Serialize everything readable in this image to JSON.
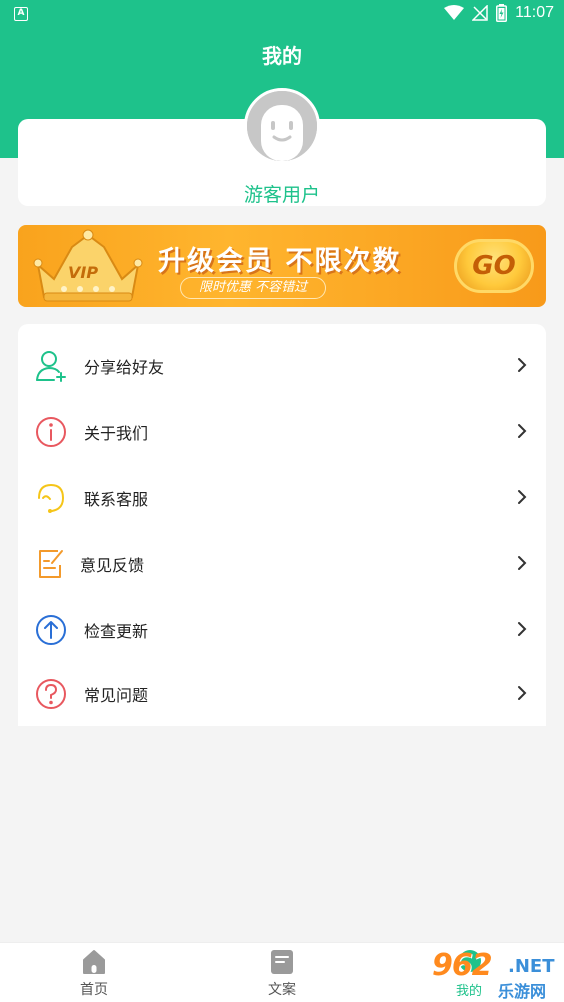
{
  "status_bar": {
    "notification_icon": "A",
    "time": "11:07",
    "icons": [
      "wifi-icon",
      "no-signal-icon",
      "battery-icon"
    ]
  },
  "header": {
    "title": "我的"
  },
  "profile": {
    "username": "游客用户",
    "avatar_icon": "default-avatar-icon"
  },
  "vip_banner": {
    "badge": "VIP",
    "headline": "升级会员 不限次数",
    "subline": "限时优惠  不容错过",
    "go_label": "GO"
  },
  "menu": {
    "items": [
      {
        "label": "分享给好友",
        "icon": "share-friend-icon",
        "color": "#1ec28b"
      },
      {
        "label": "关于我们",
        "icon": "info-icon",
        "color": "#e8585f"
      },
      {
        "label": "联系客服",
        "icon": "customer-service-icon",
        "color": "#f5c518"
      },
      {
        "label": "意见反馈",
        "icon": "feedback-icon",
        "color": "#f39a2b"
      },
      {
        "label": "检查更新",
        "icon": "update-icon",
        "color": "#2a6fd6"
      },
      {
        "label": "常见问题",
        "icon": "question-icon",
        "color": "#e8585f"
      }
    ]
  },
  "tabbar": {
    "tabs": [
      {
        "label": "首页",
        "icon": "home-icon"
      },
      {
        "label": "文案",
        "icon": "document-icon"
      },
      {
        "label": "我的",
        "icon": "profile-icon"
      }
    ]
  },
  "watermark": {
    "number": "962",
    "domain": ".NET",
    "site_name": "乐游网"
  },
  "colors": {
    "accent": "#1ec28b",
    "background": "#f4f4f4",
    "vip_orange": "#f9a31d"
  }
}
